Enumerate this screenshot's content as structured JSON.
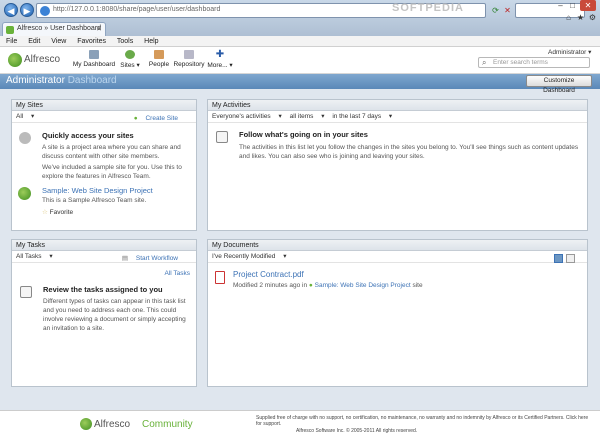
{
  "browser": {
    "url": "http://127.0.0.1:8080/share/page/user/user/dashboard",
    "watermark": "SOFTPEDIA",
    "tab_title": "Alfresco » User Dashboard"
  },
  "menubar": [
    "File",
    "Edit",
    "View",
    "Favorites",
    "Tools",
    "Help"
  ],
  "header": {
    "brand": "Alfresco",
    "nav": [
      {
        "label": "My Dashboard",
        "icon": "dashboard-icon"
      },
      {
        "label": "Sites",
        "icon": "sites-icon"
      },
      {
        "label": "People",
        "icon": "people-icon"
      },
      {
        "label": "Repository",
        "icon": "repository-icon"
      },
      {
        "label": "More...",
        "icon": "more-icon"
      }
    ],
    "user": "Administrator",
    "search_placeholder": "Enter search terms"
  },
  "titlebar": {
    "title_name": "Administrator",
    "title_suffix": "Dashboard",
    "customize": "Customize Dashboard"
  },
  "my_sites": {
    "title": "My Sites",
    "filter": "All",
    "create": "Create Site",
    "heading": "Quickly access your sites",
    "p1": "A site is a project area where you can share and discuss content with other site members.",
    "p2": "We've included a sample site for you. Use this to explore the features in Alfresco Team.",
    "site_name": "Sample: Web Site Design Project",
    "site_desc": "This is a Sample Alfresco Team site.",
    "favorite": "Favorite"
  },
  "my_activities": {
    "title": "My Activities",
    "filter1": "Everyone's activities",
    "filter2": "all items",
    "filter3": "in the last 7 days",
    "heading": "Follow what's going on in your sites",
    "p1": "The activities in this list let you follow the changes in the sites you belong to. You'll see things such as content updates and likes. You can also see who is joining and leaving your sites."
  },
  "my_tasks": {
    "title": "My Tasks",
    "filter": "All Tasks",
    "start": "Start Workflow",
    "all_tasks": "All Tasks",
    "heading": "Review the tasks assigned to you",
    "p1": "Different types of tasks can appear in this task list and you need to address each one. This could involve reviewing a document or simply accepting an invitation to a site."
  },
  "my_documents": {
    "title": "My Documents",
    "filter": "I've Recently Modified",
    "doc_name": "Project Contract.pdf",
    "doc_meta_pre": "Modified 2 minutes ago in",
    "doc_site": "Sample: Web Site Design Project",
    "doc_meta_post": "site"
  },
  "footer": {
    "brand_a": "Alfresco",
    "brand_b": "Community",
    "notice": "Supplied free of charge with no support, no certification, no maintenance, no warranty and no indemnity by Alfresco or its Certified Partners. Click here for support.",
    "copyright": "Alfresco Software Inc. © 2005-2011 All rights reserved."
  },
  "colors": {
    "accent": "#3c72b5",
    "titlebar": "#6b96c3",
    "brand_green": "#69b23a"
  }
}
